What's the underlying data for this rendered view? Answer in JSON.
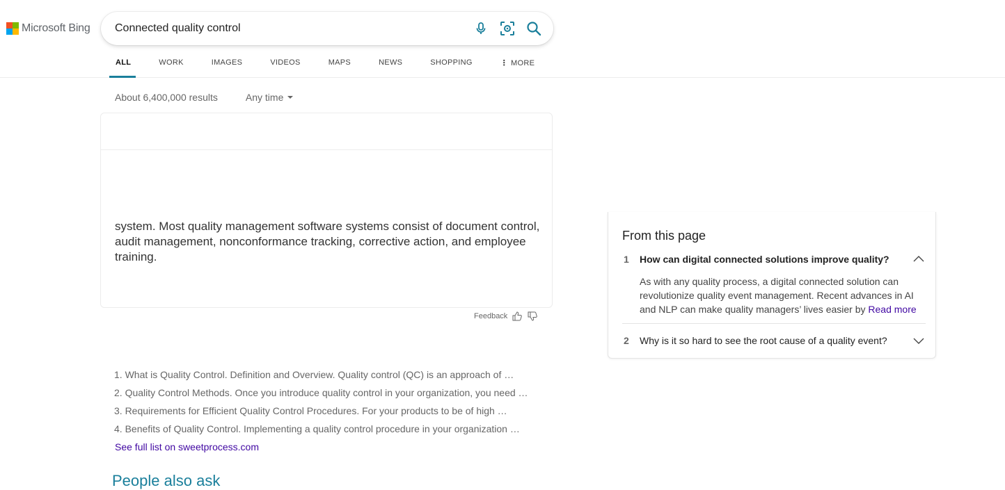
{
  "brand": {
    "name": "Microsoft Bing",
    "colors": {
      "red": "#f25022",
      "green": "#7fba00",
      "blue": "#00a4ef",
      "yellow": "#ffb900"
    }
  },
  "search": {
    "query": "Connected quality control",
    "placeholder": "",
    "icons": [
      "microphone-icon",
      "visual-search-icon",
      "search-icon"
    ],
    "accent": "#1a7f9b"
  },
  "tabs": [
    {
      "label": "ALL",
      "active": true
    },
    {
      "label": "WORK",
      "active": false
    },
    {
      "label": "IMAGES",
      "active": false
    },
    {
      "label": "VIDEOS",
      "active": false
    },
    {
      "label": "MAPS",
      "active": false
    },
    {
      "label": "NEWS",
      "active": false
    },
    {
      "label": "SHOPPING",
      "active": false
    },
    {
      "label": "MORE",
      "active": false
    }
  ],
  "results": {
    "count": "About 6,400,000 results",
    "time_filter": "Any time"
  },
  "answer": {
    "text": "system. Most quality management software systems consist of document control, audit management, nonconformance tracking, corrective action, and employee training."
  },
  "feedback": {
    "label": "Feedback"
  },
  "list": {
    "items": [
      "1. What is Quality Control. Definition and Overview. Quality control (QC) is an approach of …",
      "2. Quality Control Methods. Once you introduce quality control in your organization, you need …",
      "3. Requirements for Efficient Quality Control Procedures. For your products to be of high …",
      "4. Benefits of Quality Control. Implementing a quality control procedure in your organization …"
    ],
    "see_full": "See full list on sweetprocess.com"
  },
  "people_also_ask": "People also ask",
  "side_panel": {
    "title": "From this page",
    "items": [
      {
        "num": "1",
        "question": "How can digital connected solutions improve quality?",
        "expanded": true,
        "answer": "As with any quality process, a digital connected solution can revolutionize quality event management. Recent advances in AI and NLP can make quality managers’ lives easier by",
        "read_more": "Read more"
      },
      {
        "num": "2",
        "question": "Why is it so hard to see the root cause of a quality event?",
        "expanded": false
      }
    ]
  }
}
